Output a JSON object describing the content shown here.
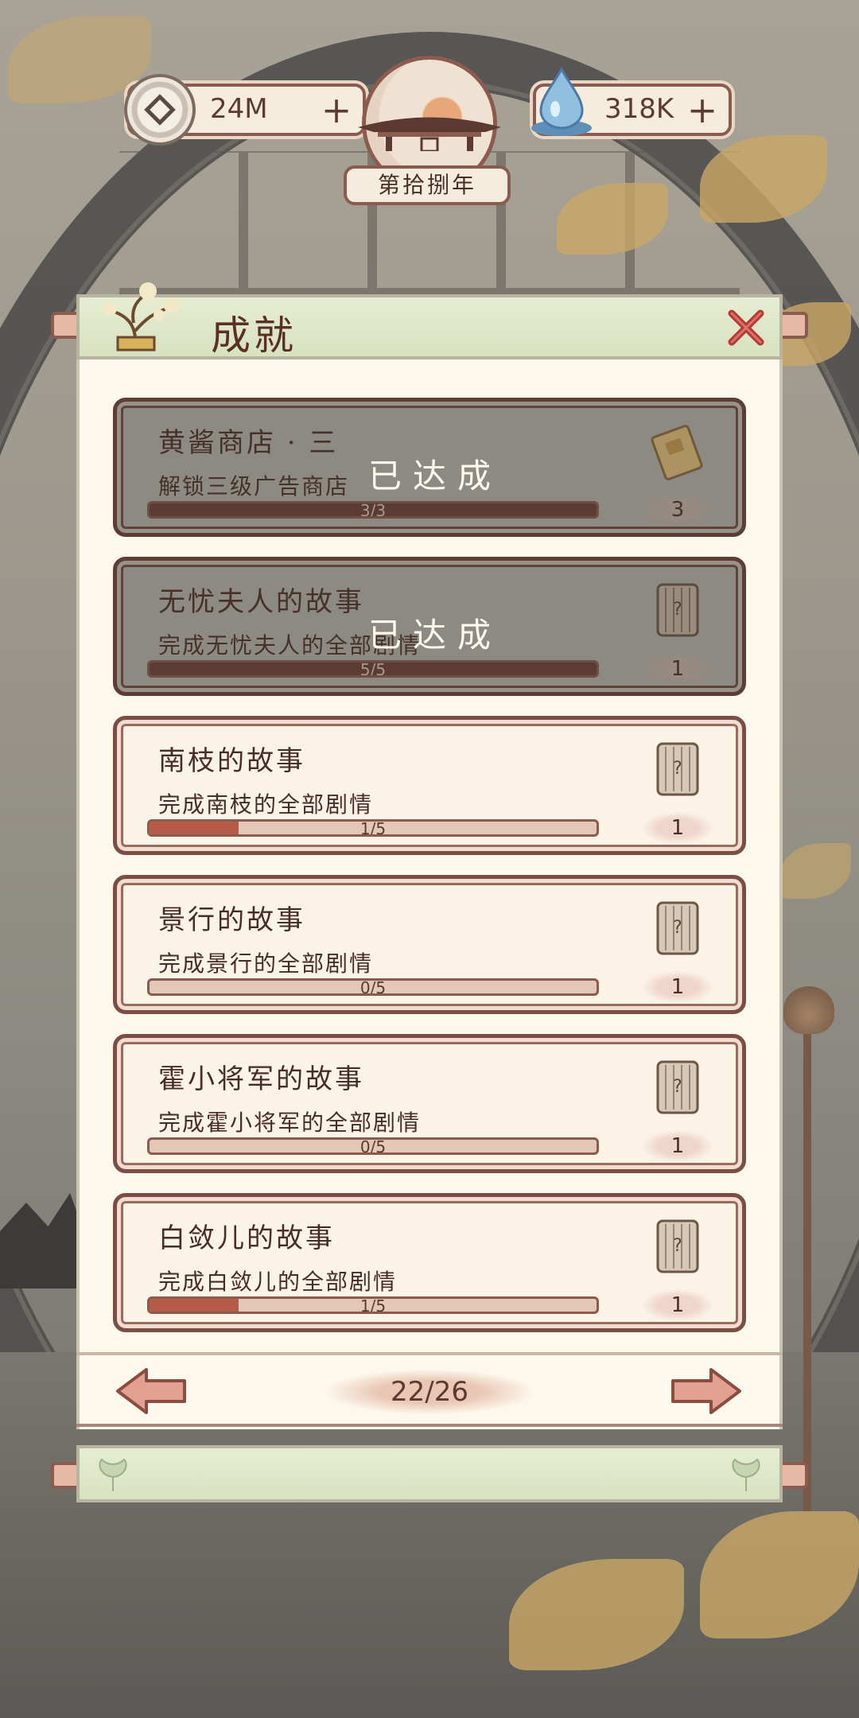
{
  "header": {
    "coins": {
      "value": "24M",
      "add": "+"
    },
    "water": {
      "value": "318K",
      "add": "+"
    },
    "year": "第拾捌年"
  },
  "panel": {
    "title": "成就",
    "close_icon": "close-x-icon"
  },
  "achievements": [
    {
      "title": "黄酱商店 · 三",
      "desc": "解锁三级广告商店",
      "progress_text": "3/3",
      "progress": 1.0,
      "reward": "3",
      "reward_icon": "ticket-icon",
      "completed": true,
      "completed_label": "已达成"
    },
    {
      "title": "无忧夫人的故事",
      "desc": "完成无忧夫人的全部剧情",
      "progress_text": "5/5",
      "progress": 1.0,
      "reward": "1",
      "reward_icon": "scroll-icon",
      "completed": true,
      "completed_label": "已达成"
    },
    {
      "title": "南枝的故事",
      "desc": "完成南枝的全部剧情",
      "progress_text": "1/5",
      "progress": 0.2,
      "reward": "1",
      "reward_icon": "scroll-icon",
      "completed": false
    },
    {
      "title": "景行的故事",
      "desc": "完成景行的全部剧情",
      "progress_text": "0/5",
      "progress": 0.0,
      "reward": "1",
      "reward_icon": "scroll-icon",
      "completed": false
    },
    {
      "title": "霍小将军的故事",
      "desc": "完成霍小将军的全部剧情",
      "progress_text": "0/5",
      "progress": 0.0,
      "reward": "1",
      "reward_icon": "scroll-icon",
      "completed": false
    },
    {
      "title": "白敛儿的故事",
      "desc": "完成白敛儿的全部剧情",
      "progress_text": "1/5",
      "progress": 0.2,
      "reward": "1",
      "reward_icon": "scroll-icon",
      "completed": false
    }
  ],
  "pagination": {
    "page": "22/26"
  },
  "colors": {
    "accent": "#b65a48",
    "frame": "#7b4e43",
    "panel": "#fdf8ec",
    "header": "#dfe8c9"
  }
}
